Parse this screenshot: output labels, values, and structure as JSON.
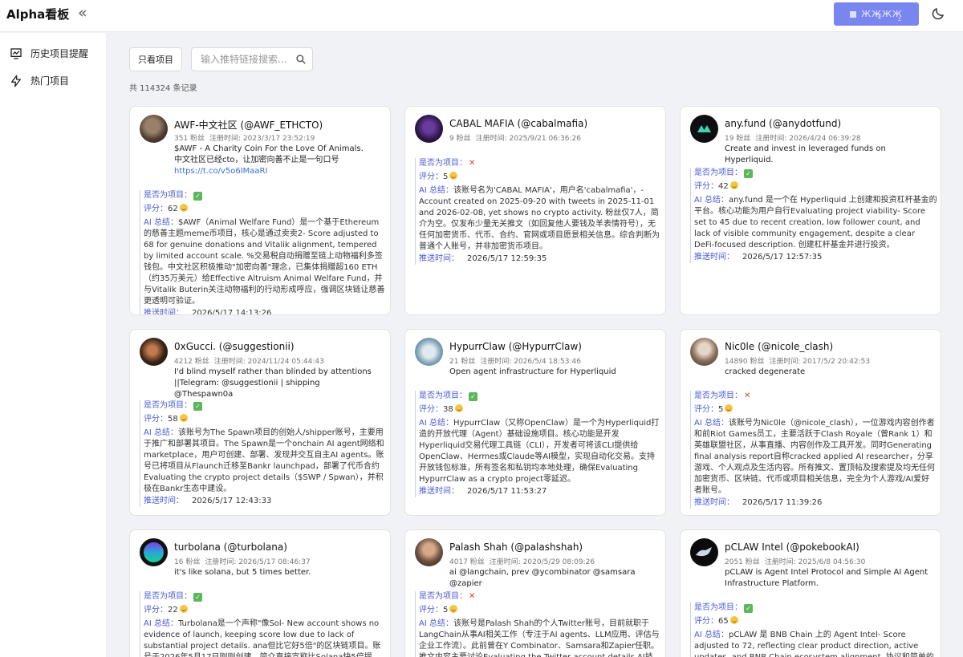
{
  "app": {
    "title": "Alpha看板",
    "collapse_icon": "«",
    "login_label": "ЖЖ̶̢̦ЖЖ̥̤"
  },
  "sidebar": {
    "items": [
      {
        "label": "历史项目提醒",
        "icon": "chart-icon"
      },
      {
        "label": "热门项目",
        "icon": "lightning-icon"
      }
    ]
  },
  "toolbar": {
    "filter_label": "只看项目",
    "search_placeholder": "输入推特链接搜索...",
    "total": "共 114324 条记录"
  },
  "labels": {
    "followers_suffix": "粉丝",
    "registered_prefix": "注册时间:",
    "is_project": "是否为项目：",
    "score": "评分：",
    "summary": "AI 总结：",
    "push_time": "推送时间："
  },
  "cards": [
    {
      "name": "AWF-中文社区 (@AWF_ETHCTO)",
      "followers": "351 粉丝",
      "registered": "注册时间: 2023/3/17 23:52:19",
      "bio": "$AWF - A Charity Coin For the Love Of Animals.\n中文社区已经cto，让加密向善不止是一句口号",
      "link": "https://t.co/v5o6IMaaRI",
      "is_project": true,
      "score": "62",
      "summary": "$AWF（Animal Welfare Fund）是一个基于Ethereum的慈善主题meme币项目，核心是通过卖卖2- Score adjusted to 68 for genuine donations and Vitalik alignment, tempered by limited account scale. %交易税自动捐赠至链上动物福利多签钱包。中文社区积极推动\"加密向善\"理念，已集体捐赠超160 ETH（约35万美元）给Effective Altruism Animal Welfare Fund，并与Vitalik Buterin关注动物福利的行动形成呼应，强调区块链让慈善更透明可验证。",
      "push_time": "2026/5/17 14:13:26"
    },
    {
      "name": "CABAL MAFIA (@cabalmafia)",
      "followers": "9 粉丝",
      "registered": "注册时间: 2025/9/21 06:36:26",
      "bio": "",
      "link": "",
      "is_project": false,
      "score": "5",
      "summary": "该账号名为'CABAL MAFIA'，用户名'cabalmafia'，- Account created on 2025-09-20 with tweets in 2025-11-01 and 2026-02-08, yet shows no crypto activity. 粉丝仅7人，简介为空。仅发布少量无关推文（如回复他人要钱及羊表情符号），无任何加密货币、代币、合约、官网或项目愿景相关信息。综合判断为普通个人账号，并非加密货币项目。",
      "push_time": "2026/5/17 12:59:35"
    },
    {
      "name": "any.fund (@anydotfund)",
      "followers": "19 粉丝",
      "registered": "注册时间: 2026/4/24 06:39:28",
      "bio": "Create and invest in leveraged funds on Hyperliquid.",
      "link": "",
      "is_project": true,
      "score": "42",
      "summary": "any.fund 是一个在 Hyperliquid 上创建和投资杠杆基金的平台。核心功能为用户自行Evaluating project viability- Score set to 45 due to recent creation, low follower count, and lack of visible community engagement, despite a clear DeFi-focused description. 创建杠杆基金并进行投资。",
      "push_time": "2026/5/17 12:57:35"
    },
    {
      "name": "0xGucci. (@suggestionii)",
      "followers": "4212 粉丝",
      "registered": "注册时间: 2024/11/24 05:44:43",
      "bio": "I'd blind myself rather than blinded by attentions ||Telegram: @suggestionii | shipping @Thespawn0a",
      "link": "",
      "is_project": true,
      "score": "58",
      "summary": "该账号为The Spawn项目的创始人/shipper账号，主要用于推广和部署其项目。The Spawn是一个onchain AI agent网络和marketplace，用户可创建、部署、发现并交互自主AI agents。账号已将项目从Flaunch迁移至Bankr launchpad，部署了代币合约 Evaluating the crypto project details（$SWP / Spwan），并积极在Bankr生态中建设。",
      "push_time": "2026/5/17 12:43:33"
    },
    {
      "name": "HypurrClaw (@HypurrClaw)",
      "followers": "21 粉丝",
      "registered": "注册时间: 2026/5/4 18:53:46",
      "bio": "Open agent infrastructure for Hyperliquid",
      "link": "",
      "is_project": true,
      "score": "38",
      "summary": "HypurrClaw（又称OpenClaw）是一个为Hyperliquid打造的开放代理（Agent）基础设施项目。核心功能是开发Hyperliquid交易代理工具链（CLI），开发者可将该CLI提供给OpenClaw、Hermes或Claude等AI模型，实现自动化交易。支持开放钱包标准，所有签名和私钥均本地处理，确保Evaluating HypurrClaw as a crypto project零延迟。",
      "push_time": "2026/5/17 11:53:27"
    },
    {
      "name": "Nic0le (@nicole_clash)",
      "followers": "14890 粉丝",
      "registered": "注册时间: 2017/5/2 20:42:53",
      "bio": "cracked degenerate",
      "link": "",
      "is_project": false,
      "score": "5",
      "summary": "该账号为Nic0le（@nicole_clash），一位游戏内容创作者和前Riot Games员工，主要活跃于Clash Royale（曾Rank 1）和英雄联盟社区，从事直播、内容创作及工具开发。同时Generating final analysis report自称cracked applied AI researcher，分享游戏、个人观点及生活内容。所有推文、置顶帖及搜索提及均无任何加密货币、区块链、代币或项目相关信息，完全为个人游戏/AI爱好者账号。",
      "push_time": "2026/5/17 11:39:26"
    },
    {
      "name": "turbolana (@turbolana)",
      "followers": "16 粉丝",
      "registered": "注册时间: 2026/5/17 08:46:37",
      "bio": "it's like solana, but 5 times better.",
      "link": "",
      "is_project": true,
      "score": "22",
      "summary": "Turbolana是一个声称\"像Sol- New account shows no evidence of launch, keeping score low due to lack of substantial project details. ana但比它好5倍\"的区块链项目。账号于2026年5月17日刚刚创建，简介直接宣称比Solana快5倍提升，目前仅有一条",
      "push_time": ""
    },
    {
      "name": "Palash Shah (@palashshah)",
      "followers": "4017 粉丝",
      "registered": "注册时间: 2020/5/29 08:09:26",
      "bio": "ai @langchain, prev @ycombinator @samsara @zapier",
      "link": "",
      "is_project": false,
      "score": "5",
      "summary": "该账号是Palash Shah的个人Twitter账号，目前就职于LangChain从事AI相关工作（专注于AI agents、LLM应用、评估与企业工作流）。此前曾在Y Combinator、Samsara和Zapier任职。推文内容主要讨论Evaluating the Twitter account details AI技术，代码开",
      "push_time": ""
    },
    {
      "name": "pCLAW Intel (@pokebookAI)",
      "followers": "2051 粉丝",
      "registered": "注册时间: 2025/6/8 04:56:30",
      "bio": "pCLAW is Agent Intel Protocol and Simple AI Agent Infrastructure Platform.",
      "link": "",
      "is_project": true,
      "score": "65",
      "summary": "pCLAW 是 BNB Chain 上的 Agent Intel- Score adjusted to 72, reflecting clear product direction, active updates, and BNB Chain ecosystem alignment. 协议和简单的AI代理基础设施平台。",
      "push_time": ""
    }
  ]
}
